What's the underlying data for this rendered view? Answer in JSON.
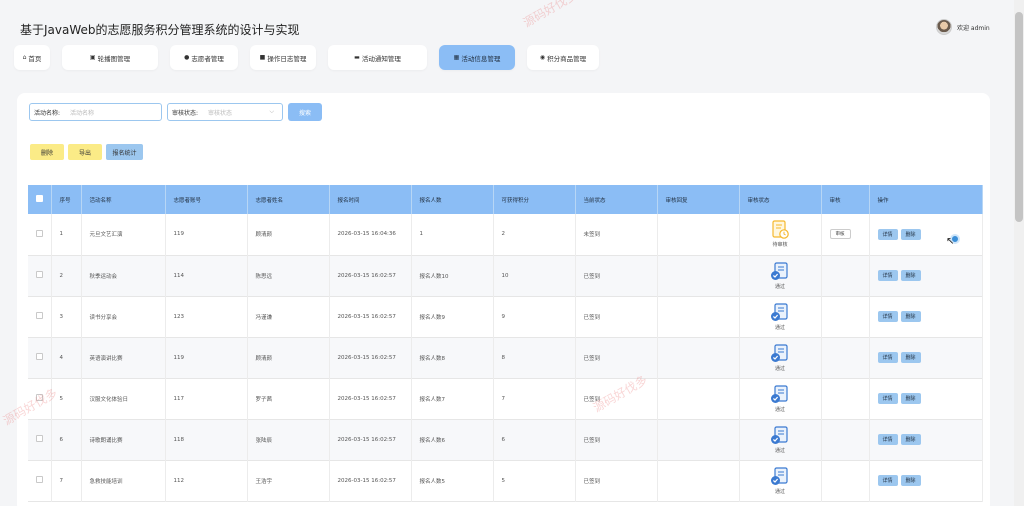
{
  "app": {
    "title": "基于JavaWeb的志愿服务积分管理系统的设计与实现",
    "welcome": "欢迎 admin"
  },
  "nav": [
    {
      "icon": "home-icon",
      "glyph": "⌂",
      "label": "首页",
      "active": false,
      "w": 36
    },
    {
      "icon": "image-icon",
      "glyph": "▣",
      "label": "轮播图管理",
      "active": false,
      "w": 96
    },
    {
      "icon": "user-icon",
      "glyph": "●",
      "label": "志愿者管理",
      "active": false,
      "w": 68
    },
    {
      "icon": "log-icon",
      "glyph": "■",
      "label": "操作日志管理",
      "active": false,
      "w": 66
    },
    {
      "icon": "folder-icon",
      "glyph": "▬",
      "label": "活动通知管理",
      "active": false,
      "w": 99
    },
    {
      "icon": "grid-icon",
      "glyph": "▦",
      "label": "活动信息管理",
      "active": true,
      "w": 76
    },
    {
      "icon": "gift-icon",
      "glyph": "◉",
      "label": "积分商品管理",
      "active": false,
      "w": 72
    }
  ],
  "search": {
    "name_label": "活动名称:",
    "name_placeholder": "活动名称",
    "status_label": "审核状态:",
    "status_placeholder": "审核状态",
    "button": "搜索"
  },
  "actions": {
    "delete": "删除",
    "export": "导出",
    "stats": "报名统计"
  },
  "table": {
    "headers": [
      "序号",
      "活动名称",
      "志愿者账号",
      "志愿者姓名",
      "报名时间",
      "报名人数",
      "可获得积分",
      "当前状态",
      "审核回复",
      "审核状态",
      "审核",
      "操作"
    ],
    "rows": [
      {
        "no": "1",
        "name": "元旦文艺汇演",
        "account": "119",
        "person": "顾清颜",
        "time": "2026-03-15 16:04:36",
        "count": "1",
        "points": "2",
        "state": "未签到",
        "reply": "",
        "audit_status": "待审核",
        "audit_kind": "pending",
        "audit_btn": "审核"
      },
      {
        "no": "2",
        "name": "秋季运动会",
        "account": "114",
        "person": "陈思远",
        "time": "2026-03-15 16:02:57",
        "count": "报名人数10",
        "points": "10",
        "state": "已签到",
        "reply": "",
        "audit_status": "通过",
        "audit_kind": "passed",
        "audit_btn": ""
      },
      {
        "no": "3",
        "name": "读书分享会",
        "account": "123",
        "person": "冯谨谦",
        "time": "2026-03-15 16:02:57",
        "count": "报名人数9",
        "points": "9",
        "state": "已签到",
        "reply": "",
        "audit_status": "通过",
        "audit_kind": "passed",
        "audit_btn": ""
      },
      {
        "no": "4",
        "name": "英语演讲比赛",
        "account": "119",
        "person": "顾清颜",
        "time": "2026-03-15 16:02:57",
        "count": "报名人数8",
        "points": "8",
        "state": "已签到",
        "reply": "",
        "audit_status": "通过",
        "audit_kind": "passed",
        "audit_btn": ""
      },
      {
        "no": "5",
        "name": "汉服文化体验日",
        "account": "117",
        "person": "罗子茜",
        "time": "2026-03-15 16:02:57",
        "count": "报名人数7",
        "points": "7",
        "state": "已签到",
        "reply": "",
        "audit_status": "通过",
        "audit_kind": "passed",
        "audit_btn": ""
      },
      {
        "no": "6",
        "name": "诗歌朗诵比赛",
        "account": "118",
        "person": "张陆辰",
        "time": "2026-03-15 16:02:57",
        "count": "报名人数6",
        "points": "6",
        "state": "已签到",
        "reply": "",
        "audit_status": "通过",
        "audit_kind": "passed",
        "audit_btn": ""
      },
      {
        "no": "7",
        "name": "急救技能培训",
        "account": "112",
        "person": "王浩宇",
        "time": "2026-03-15 16:02:57",
        "count": "报名人数5",
        "points": "5",
        "state": "已签到",
        "reply": "",
        "audit_status": "通过",
        "audit_kind": "passed",
        "audit_btn": ""
      }
    ],
    "op_detail": "详情",
    "op_delete": "删除"
  },
  "watermark": "源码好伐多",
  "colors": {
    "accent": "#8bbdf5",
    "yellow_btn": "#fbeb87",
    "pending": "#f5b82e",
    "passed": "#3b7ad1"
  }
}
